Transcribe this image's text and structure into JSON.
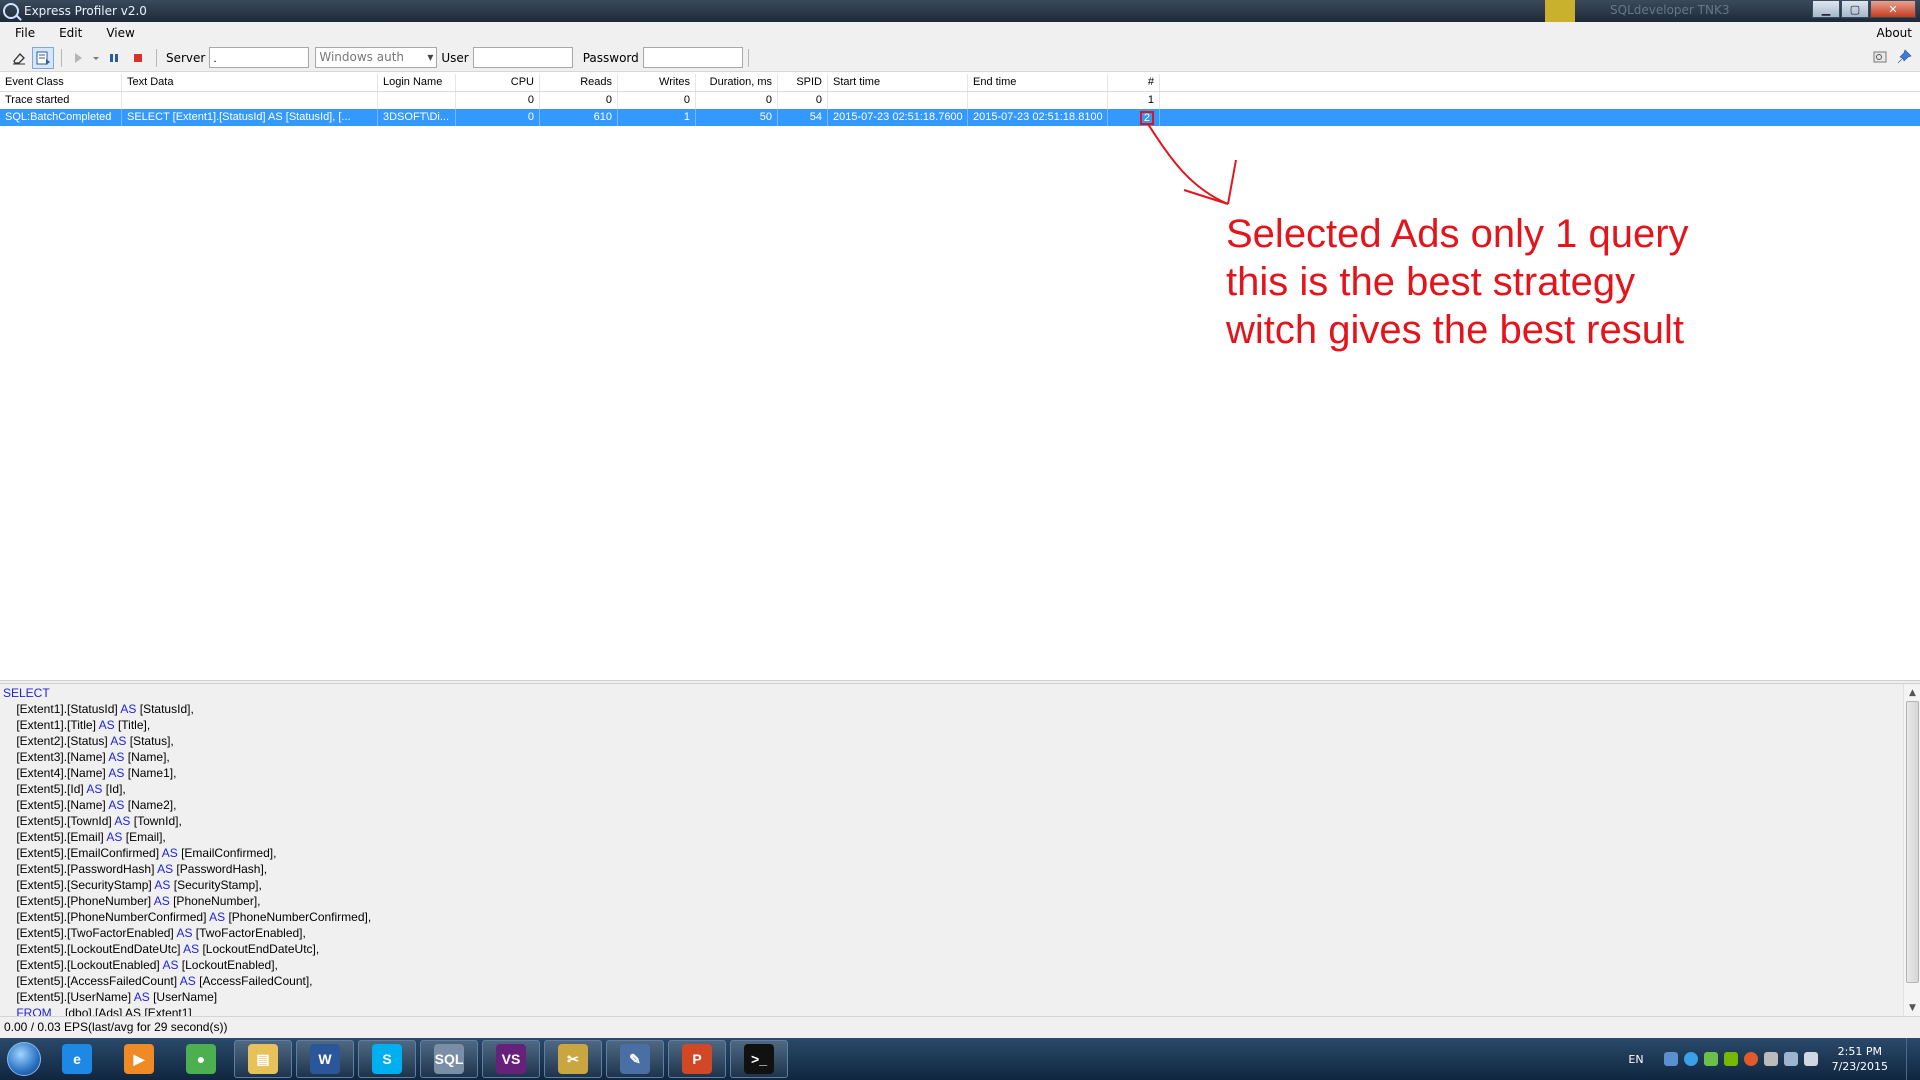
{
  "window": {
    "title": "Express Profiler v2.0",
    "background_tab": "SQLdeveloper TNK3"
  },
  "menu": {
    "file": "File",
    "edit": "Edit",
    "view": "View",
    "about": "About"
  },
  "toolbar": {
    "server_label": "Server",
    "server_value": ".",
    "auth_value": "Windows auth",
    "user_label": "User",
    "user_value": "",
    "password_label": "Password",
    "password_value": ""
  },
  "grid": {
    "columns": [
      "Event Class",
      "Text Data",
      "Login Name",
      "CPU",
      "Reads",
      "Writes",
      "Duration, ms",
      "SPID",
      "Start time",
      "End time",
      "#"
    ],
    "rows": [
      {
        "event_class": "Trace started",
        "text_data": "",
        "login_name": "",
        "cpu": "0",
        "reads": "0",
        "writes": "0",
        "duration": "0",
        "spid": "0",
        "start_time": "",
        "end_time": "",
        "num": "1"
      },
      {
        "event_class": "SQL:BatchCompleted",
        "text_data": "SELECT     [Extent1].[StatusId] AS [StatusId],     [...",
        "login_name": "3DSOFT\\Di...",
        "cpu": "0",
        "reads": "610",
        "writes": "1",
        "duration": "50",
        "spid": "54",
        "start_time": "2015-07-23 02:51:18.7600",
        "end_time": "2015-07-23 02:51:18.8100",
        "num": "2"
      }
    ]
  },
  "annotation": {
    "line1": "Selected Ads only 1 query",
    "line2": "this is the best strategy",
    "line3": "witch gives the best result",
    "color": "#e3141b"
  },
  "sql": {
    "keyword_color": "#2323d6",
    "lines": [
      {
        "pre": "",
        "kw": "SELECT",
        "post": ""
      },
      {
        "pre": "    [Extent1].[StatusId] ",
        "kw": "AS",
        "post": " [StatusId],"
      },
      {
        "pre": "    [Extent1].[Title] ",
        "kw": "AS",
        "post": " [Title],"
      },
      {
        "pre": "    [Extent2].[Status] ",
        "kw": "AS",
        "post": " [Status],"
      },
      {
        "pre": "    [Extent3].[Name] ",
        "kw": "AS",
        "post": " [Name],"
      },
      {
        "pre": "    [Extent4].[Name] ",
        "kw": "AS",
        "post": " [Name1],"
      },
      {
        "pre": "    [Extent5].[Id] ",
        "kw": "AS",
        "post": " [Id],"
      },
      {
        "pre": "    [Extent5].[Name] ",
        "kw": "AS",
        "post": " [Name2],"
      },
      {
        "pre": "    [Extent5].[TownId] ",
        "kw": "AS",
        "post": " [TownId],"
      },
      {
        "pre": "    [Extent5].[Email] ",
        "kw": "AS",
        "post": " [Email],"
      },
      {
        "pre": "    [Extent5].[EmailConfirmed] ",
        "kw": "AS",
        "post": " [EmailConfirmed],"
      },
      {
        "pre": "    [Extent5].[PasswordHash] ",
        "kw": "AS",
        "post": " [PasswordHash],"
      },
      {
        "pre": "    [Extent5].[SecurityStamp] ",
        "kw": "AS",
        "post": " [SecurityStamp],"
      },
      {
        "pre": "    [Extent5].[PhoneNumber] ",
        "kw": "AS",
        "post": " [PhoneNumber],"
      },
      {
        "pre": "    [Extent5].[PhoneNumberConfirmed] ",
        "kw": "AS",
        "post": " [PhoneNumberConfirmed],"
      },
      {
        "pre": "    [Extent5].[TwoFactorEnabled] ",
        "kw": "AS",
        "post": " [TwoFactorEnabled],"
      },
      {
        "pre": "    [Extent5].[LockoutEndDateUtc] ",
        "kw": "AS",
        "post": " [LockoutEndDateUtc],"
      },
      {
        "pre": "    [Extent5].[LockoutEnabled] ",
        "kw": "AS",
        "post": " [LockoutEnabled],"
      },
      {
        "pre": "    [Extent5].[AccessFailedCount] ",
        "kw": "AS",
        "post": " [AccessFailedCount],"
      },
      {
        "pre": "    [Extent5].[UserName] ",
        "kw": "AS",
        "post": " [UserName]"
      },
      {
        "pre": "    ",
        "kw": "FROM",
        "post": "    [dbo].[Ads] AS [Extent1]"
      }
    ]
  },
  "status": {
    "text": "0.00 / 0.03 EPS(last/avg for 29 second(s))"
  },
  "taskbar": {
    "apps": [
      {
        "name": "internet-explorer",
        "label": "e",
        "color": "#1e88e5"
      },
      {
        "name": "media-player",
        "label": "▶",
        "color": "#f08a24"
      },
      {
        "name": "chrome",
        "label": "●",
        "color": "#4caf50"
      },
      {
        "name": "file-explorer",
        "label": "▤",
        "color": "#e7c25a"
      },
      {
        "name": "word",
        "label": "W",
        "color": "#2b579a"
      },
      {
        "name": "skype",
        "label": "S",
        "color": "#00aff0"
      },
      {
        "name": "sql-profiler",
        "label": "SQL",
        "color": "#7a8fa6"
      },
      {
        "name": "visual-studio",
        "label": "VS",
        "color": "#68217a"
      },
      {
        "name": "tools",
        "label": "✂",
        "color": "#c9a640"
      },
      {
        "name": "editor",
        "label": "✎",
        "color": "#4a6fa5"
      },
      {
        "name": "powerpoint",
        "label": "P",
        "color": "#d24726"
      },
      {
        "name": "console",
        "label": ">_",
        "color": "#111111"
      }
    ],
    "lang": "EN",
    "time": "2:51 PM",
    "date": "7/23/2015"
  }
}
